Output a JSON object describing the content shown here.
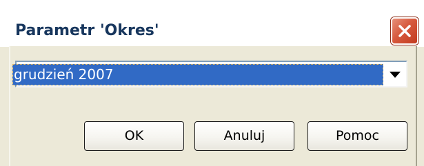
{
  "window": {
    "title": "Parametr 'Okres'",
    "close_icon": "close-icon"
  },
  "period_select": {
    "selected_value": "grudzień 2007",
    "arrow_icon": "chevron-down-icon"
  },
  "buttons": {
    "ok_label": "OK",
    "cancel_label": "Anuluj",
    "help_label": "Pomoc"
  },
  "colors": {
    "title_text": "#17365d",
    "dialog_background": "#ece9d8",
    "selection_highlight": "#316ac5",
    "close_button": "#d75a3e"
  }
}
